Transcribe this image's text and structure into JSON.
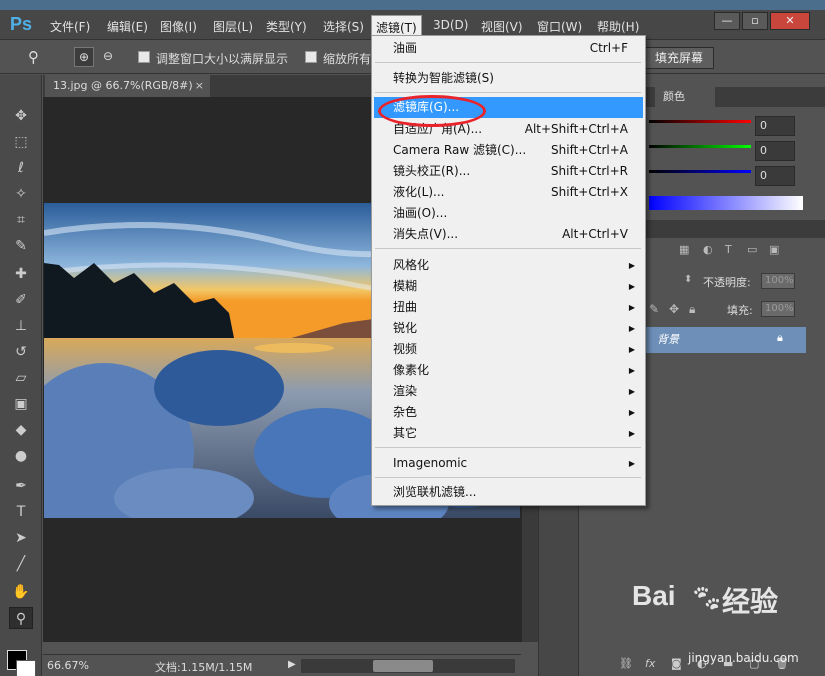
{
  "app": {
    "logo": "Ps"
  },
  "menubar": {
    "items": [
      "文件(F)",
      "编辑(E)",
      "图像(I)",
      "图层(L)",
      "类型(Y)",
      "选择(S)",
      "滤镜(T)",
      "3D(D)",
      "视图(V)",
      "窗口(W)",
      "帮助(H)"
    ],
    "active_index": 6,
    "window_buttons": {
      "minimize": "—",
      "restore": "▫",
      "close": "✕"
    }
  },
  "optbar": {
    "check1_label": "调整窗口大小以满屏显示",
    "check2_label": "缩放所有",
    "fill_screen_label": "填充屏幕"
  },
  "document": {
    "tab_title": "13.jpg @ 66.7%(RGB/8#)",
    "tab_close": "×"
  },
  "status": {
    "zoom": "66.67%",
    "doc_size": "文档:1.15M/1.15M"
  },
  "filter_menu": {
    "items": [
      {
        "label": "油画",
        "shortcut": "Ctrl+F"
      },
      {
        "label": "转换为智能滤镜(S)",
        "shortcut": ""
      },
      {
        "label": "滤镜库(G)...",
        "shortcut": "",
        "highlighted": true
      },
      {
        "label": "自适应广角(A)...",
        "shortcut": "Alt+Shift+Ctrl+A"
      },
      {
        "label": "Camera Raw 滤镜(C)...",
        "shortcut": "Shift+Ctrl+A"
      },
      {
        "label": "镜头校正(R)...",
        "shortcut": "Shift+Ctrl+R"
      },
      {
        "label": "液化(L)...",
        "shortcut": "Shift+Ctrl+X"
      },
      {
        "label": "油画(O)...",
        "shortcut": ""
      },
      {
        "label": "消失点(V)...",
        "shortcut": "Alt+Ctrl+V"
      },
      {
        "label": "风格化",
        "submenu": true
      },
      {
        "label": "模糊",
        "submenu": true
      },
      {
        "label": "扭曲",
        "submenu": true
      },
      {
        "label": "锐化",
        "submenu": true
      },
      {
        "label": "视频",
        "submenu": true
      },
      {
        "label": "像素化",
        "submenu": true
      },
      {
        "label": "渲染",
        "submenu": true
      },
      {
        "label": "杂色",
        "submenu": true
      },
      {
        "label": "其它",
        "submenu": true
      },
      {
        "label": "Imagenomic",
        "submenu": true
      },
      {
        "label": "浏览联机滤镜..."
      }
    ]
  },
  "right_panel": {
    "color_tab": "颜色",
    "rgb_values": [
      "0",
      "0",
      "0"
    ],
    "opacity_label": "不透明度:",
    "opacity_value": "100%",
    "fill_label": "填充:",
    "fill_value": "100%",
    "layer_name": "背景"
  },
  "watermark": {
    "brand": "Bai",
    "brand2": "经验",
    "url": "jingyan.baidu.com"
  }
}
